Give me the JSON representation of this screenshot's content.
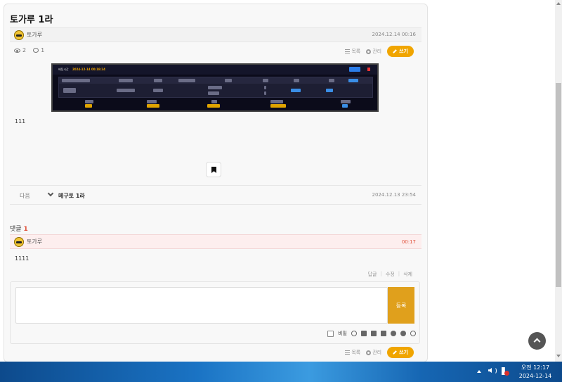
{
  "post": {
    "title": "토가루 1라",
    "author": "토가루",
    "date": "2024.12.14 00:16",
    "views": "2",
    "comments": "1",
    "list_label": "목록",
    "manage_label": "관리",
    "write_label": "쓰기",
    "body": "111"
  },
  "embedded_screenshot": {
    "time_label": "배팅시간",
    "time_value": "2024-12-14 00:18:24"
  },
  "navigation": {
    "next_label": "다음",
    "next_title": "메구토 1라",
    "next_date": "2024.12.13 23:54"
  },
  "comments": {
    "heading": "댓글",
    "count": "1",
    "items": [
      {
        "author": "토가루",
        "time": "00:17",
        "text": "1111",
        "reply_label": "답글",
        "edit_label": "수정",
        "delete_label": "삭제"
      }
    ]
  },
  "editor": {
    "submit_label": "등록",
    "secret_label": "비밀"
  },
  "footer_actions": {
    "list_label": "목록",
    "manage_label": "관리",
    "write_label": "쓰기"
  },
  "taskbar": {
    "time": "오전 12:17",
    "date": "2024-12-14"
  },
  "colors": {
    "accent": "#f0a500",
    "comment_highlight": "#fdeeee",
    "taskbar": "#1a73c4"
  }
}
